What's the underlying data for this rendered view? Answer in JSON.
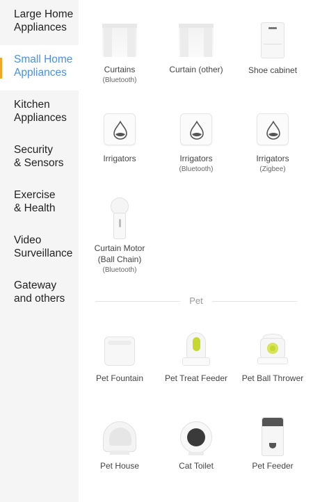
{
  "sidebar": {
    "categories": [
      {
        "line1": "Large Home",
        "line2": "Appliances"
      },
      {
        "line1": "Small Home",
        "line2": "Appliances"
      },
      {
        "line1": "Kitchen",
        "line2": "Appliances"
      },
      {
        "line1": "Security",
        "line2": "& Sensors"
      },
      {
        "line1": "Exercise",
        "line2": "& Health"
      },
      {
        "line1": "Video",
        "line2": "Surveillance"
      },
      {
        "line1": "Gateway",
        "line2": "and others"
      }
    ],
    "active_index": 1,
    "active_color": "#4a90e2",
    "indicator_color": "#f5a623"
  },
  "devices": [
    {
      "label": "Curtains",
      "sub": "(Bluetooth)",
      "icon": "curtain-icon"
    },
    {
      "label": "Curtain (other)",
      "sub": "",
      "icon": "curtain-icon"
    },
    {
      "label": "Shoe cabinet",
      "sub": "",
      "icon": "shoe-cabinet-icon"
    },
    {
      "label": "Irrigators",
      "sub": "",
      "icon": "irrigator-icon"
    },
    {
      "label": "Irrigators",
      "sub": "(Bluetooth)",
      "icon": "irrigator-icon"
    },
    {
      "label": "Irrigators",
      "sub": "(Zigbee)",
      "icon": "irrigator-icon"
    },
    {
      "label": "Curtain Motor",
      "line2": "(Ball Chain)",
      "sub": "(Bluetooth)",
      "icon": "curtain-motor-icon"
    }
  ],
  "pet_section": {
    "title": "Pet",
    "devices": [
      {
        "label": "Pet Fountain",
        "icon": "pet-fountain-icon"
      },
      {
        "label": "Pet Treat Feeder",
        "icon": "pet-treat-feeder-icon"
      },
      {
        "label": "Pet Ball Thrower",
        "icon": "pet-ball-thrower-icon"
      },
      {
        "label": "Pet House",
        "icon": "pet-house-icon"
      },
      {
        "label": "Cat Toilet",
        "icon": "cat-toilet-icon"
      },
      {
        "label": "Pet Feeder",
        "icon": "pet-feeder-icon"
      }
    ],
    "accent_color": "#c6d730"
  }
}
